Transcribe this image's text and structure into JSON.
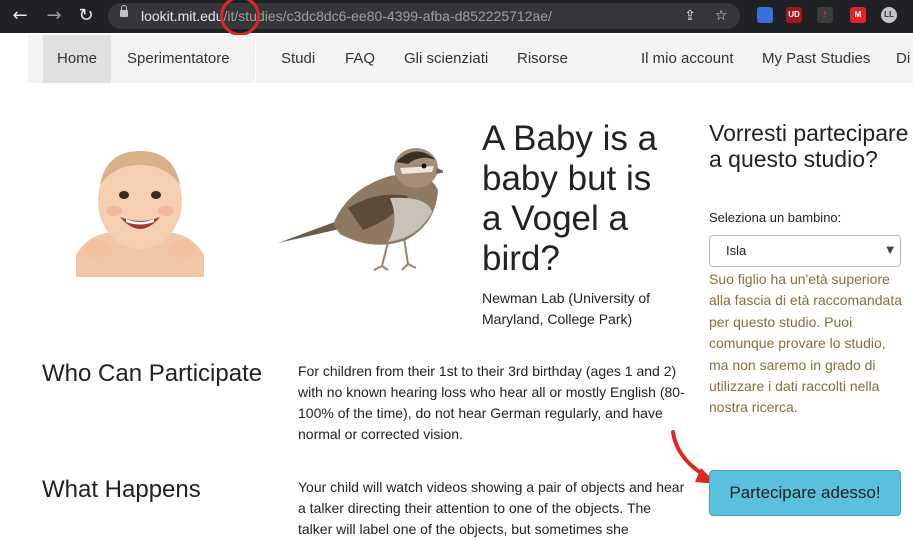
{
  "browser": {
    "url_host": "lookit.mit.edu",
    "url_path": "/it/studies/c3dc8dc6-ee80-4399-afba-d852225712ae/",
    "extensions": [
      "UD",
      "M"
    ]
  },
  "nav": {
    "home": "Home",
    "experimenter": "Sperimentatore",
    "studies": "Studi",
    "faq": "FAQ",
    "scientists": "Gli scienziati",
    "resources": "Risorse",
    "account": "Il mio account",
    "past_studies": "My Past Studies",
    "cutoff": "Di"
  },
  "study": {
    "title": "A Baby is a baby but is a Vogel a bird?",
    "lab": "Newman Lab (University of Maryland, College Park)"
  },
  "sections": {
    "who_heading": "Who Can Participate",
    "who_text": "For children from their 1st to their 3rd birthday (ages 1 and 2) with no known hearing loss who hear all or mostly English (80-100% of the time), do not hear German regularly, and have normal or corrected vision.",
    "what_heading": "What Happens",
    "what_text": "Your child will watch videos showing a pair of objects and hear a talker directing their attention to one of the objects. The talker will label one of the objects, but sometimes she"
  },
  "aside": {
    "heading": "Vorresti partecipare a questo studio?",
    "select_label": "Seleziona un bambino:",
    "selected_child": "Isla",
    "warning": "Suo figlio ha un'età superiore alla fascia di età raccomandata per questo studio. Puoi comunque provare lo studio, ma non saremo in grado di utilizzare i dati raccolti nella nostra ricerca.",
    "cta": "Partecipare adesso!"
  },
  "colors": {
    "cta": "#5bc0de",
    "warning_text": "#8a6d3b",
    "annotation": "#e0271b"
  }
}
